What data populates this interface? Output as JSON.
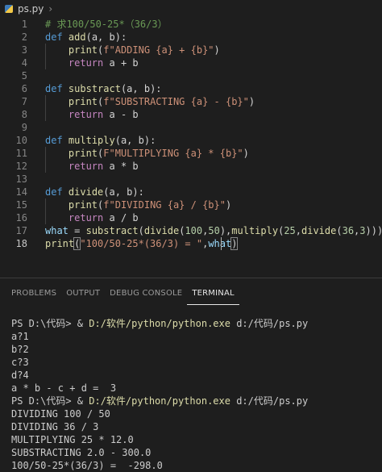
{
  "breadcrumb": {
    "file": "ps.py",
    "separator": "›"
  },
  "editor": {
    "line_numbers": [
      "1",
      "2",
      "3",
      "4",
      "5",
      "6",
      "7",
      "8",
      "9",
      "10",
      "11",
      "12",
      "13",
      "14",
      "15",
      "16",
      "17",
      "18"
    ],
    "comment": "# 求100/50-25*（36/3）",
    "add_def_kw": "def",
    "add_def_name": "add",
    "add_def_args": "(a, b):",
    "add_print_fn": "print",
    "add_print_open": "(",
    "add_print_str": "f\"ADDING {a} + {b}\"",
    "add_print_close": ")",
    "add_return_kw": "return",
    "add_return_expr": " a + b",
    "sub_def_kw": "def",
    "sub_def_name": "substract",
    "sub_def_args": "(a, b):",
    "sub_print_fn": "print",
    "sub_print_open": "(",
    "sub_print_str": "f\"SUBSTRACTING {a} - {b}\"",
    "sub_print_close": ")",
    "sub_return_kw": "return",
    "sub_return_expr": " a - b",
    "mul_def_kw": "def",
    "mul_def_name": "multiply",
    "mul_def_args": "(a, b):",
    "mul_print_fn": "print",
    "mul_print_open": "(",
    "mul_print_str": "F\"MULTIPLYING {a} * {b}\"",
    "mul_print_close": ")",
    "mul_return_kw": "return",
    "mul_return_expr": " a * b",
    "div_def_kw": "def",
    "div_def_name": "divide",
    "div_def_args": "(a, b):",
    "div_print_fn": "print",
    "div_print_open": "(",
    "div_print_str": "f\"DIVIDING {a} / {b}\"",
    "div_print_close": ")",
    "div_return_kw": "return",
    "div_return_expr": " a / b",
    "l17_var": "what",
    "l17_eq": " = ",
    "l17_f1": "substract",
    "l17_p1": "(",
    "l17_f2": "divide",
    "l17_p2": "(",
    "l17_n1": "100",
    "l17_c1": ",",
    "l17_n2": "50",
    "l17_p3": "),",
    "l17_f3": "multiply",
    "l17_p4": "(",
    "l17_n3": "25",
    "l17_c2": ",",
    "l17_f4": "divide",
    "l17_p5": "(",
    "l17_n4": "36",
    "l17_c3": ",",
    "l17_n5": "3",
    "l17_p6": ")))",
    "l18_fn": "print",
    "l18_open": "(",
    "l18_str": "\"100/50-25*(36/3) = \"",
    "l18_comma": ",",
    "l18_var": "what",
    "l18_close": ")"
  },
  "panel": {
    "tabs": [
      "PROBLEMS",
      "OUTPUT",
      "DEBUG CONSOLE",
      "TERMINAL"
    ],
    "active_tab": "TERMINAL"
  },
  "terminal": {
    "prompt1": "PS D:\\代码> & ",
    "cmd1": "D:/软件/python/python.exe",
    "args1": " d:/代码/ps.py",
    "out1": [
      "a?1",
      "b?2",
      "c?3",
      "d?4",
      "a * b - c + d =  3"
    ],
    "prompt2": "PS D:\\代码> & ",
    "cmd2": "D:/软件/python/python.exe",
    "args2": " d:/代码/ps.py",
    "out2": [
      "DIVIDING 100 / 50",
      "DIVIDING 36 / 3",
      "MULTIPLYING 25 * 12.0",
      "SUBSTRACTING 2.0 - 300.0",
      "100/50-25*(36/3) =  -298.0"
    ]
  }
}
